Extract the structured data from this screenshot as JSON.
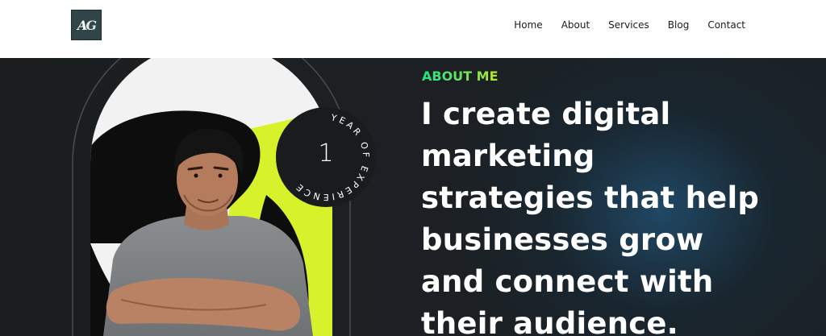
{
  "header": {
    "logo": {
      "text_a": "A",
      "text_g": "G"
    },
    "nav": [
      {
        "label": "Home"
      },
      {
        "label": "About"
      },
      {
        "label": "Services"
      },
      {
        "label": "Blog"
      },
      {
        "label": "Contact"
      }
    ]
  },
  "hero": {
    "eyebrow": "ABOUT ME",
    "headline": "I create digital marketing strategies that help businesses grow and connect with their audience.",
    "badge": {
      "number": "1",
      "caption": "YEAR OF EXPERIENCE"
    }
  },
  "colors": {
    "accent_green": "#1ee38a",
    "accent_lime": "#d7f22a",
    "hero_background": "#1b1f21",
    "text_light": "#ffffff"
  }
}
